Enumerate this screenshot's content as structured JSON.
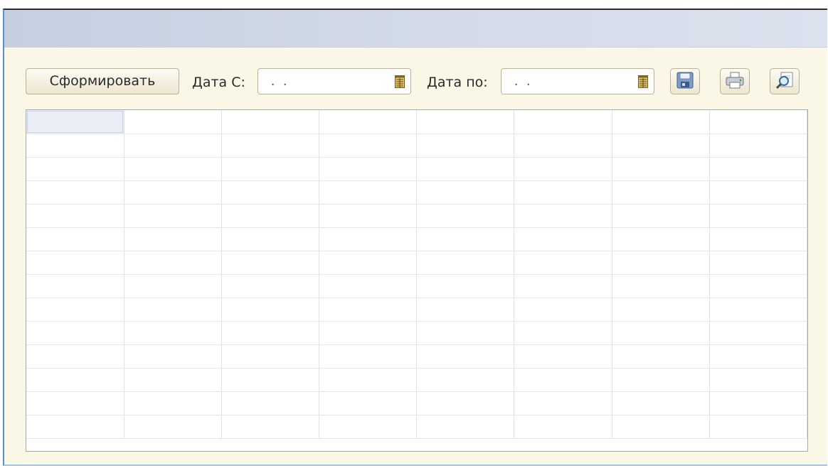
{
  "toolbar": {
    "generate_label": "Сформировать",
    "date_from_label": "Дата С:",
    "date_from_value": " .  .",
    "date_to_label": "Дата по:",
    "date_to_value": " .  .",
    "icons": {
      "calendar": "calendar-icon",
      "save": "save-icon",
      "print": "print-icon",
      "preview": "print-preview-icon"
    }
  },
  "grid": {
    "columns": 8,
    "rows": 14,
    "selected_cell": [
      0,
      0
    ]
  },
  "colors": {
    "form_background": "#fbf7e6",
    "titlebar": "#d2dae8",
    "grid_line": "#e1e1e1",
    "selection": "#e9eef7"
  }
}
